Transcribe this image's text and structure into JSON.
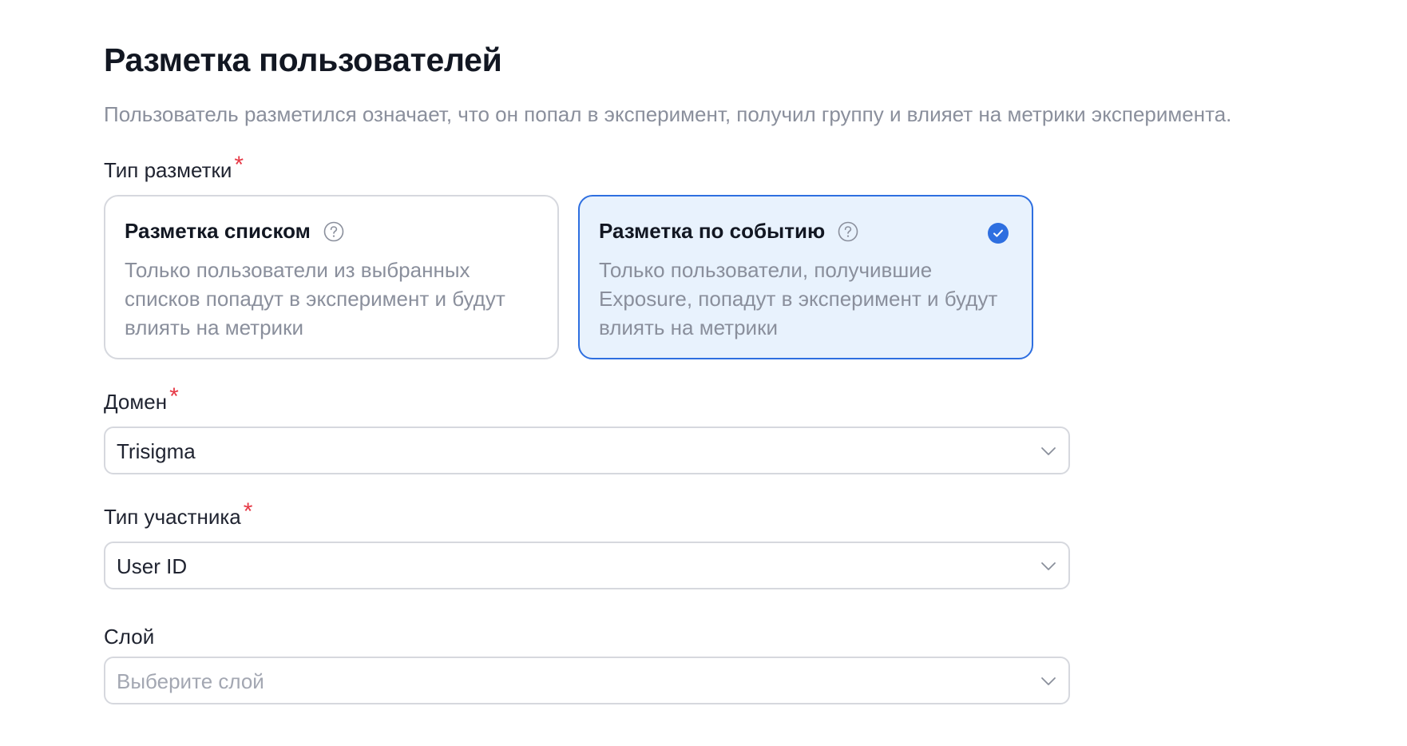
{
  "header": {
    "title": "Разметка пользователей",
    "subtitle": "Пользователь разметился означает, что он попал в эксперимент, получил группу и влияет на метрики эксперимента."
  },
  "markup_type": {
    "label": "Тип разметки",
    "required_mark": "*",
    "options": [
      {
        "title": "Разметка списком",
        "description": "Только пользователи из выбранных списков попадут в эксперимент и будут влиять на метрики",
        "icon": "help-circle-icon",
        "selected": false
      },
      {
        "title": "Разметка по событию",
        "description": "Только пользователи, получившие Exposure, попадут в эксперимент и будут влиять на метрики",
        "icon": "help-circle-icon",
        "selected": true
      }
    ]
  },
  "domain": {
    "label": "Домен",
    "required_mark": "*",
    "value": "Trisigma"
  },
  "participant_type": {
    "label": "Тип участника",
    "required_mark": "*",
    "value": "User ID"
  },
  "layer": {
    "label": "Слой",
    "placeholder": "Выберите слой"
  },
  "colors": {
    "accent": "#2e6fe0",
    "selected_bg": "#e8f2fd",
    "required": "#e63946",
    "muted_text": "#8a8f9c",
    "border": "#d6d8de"
  }
}
